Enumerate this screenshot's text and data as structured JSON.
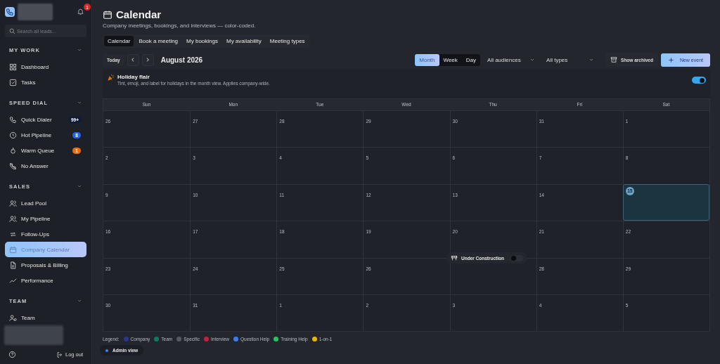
{
  "sidebar": {
    "notifications": "1",
    "search": {
      "placeholder": "Search all leads..."
    },
    "sections": [
      {
        "title": "MY WORK",
        "expanded": true,
        "items": [
          {
            "label": "Dashboard",
            "selected": false
          },
          {
            "label": "Tasks",
            "selected": false
          }
        ]
      },
      {
        "title": "SPEED DIAL",
        "expanded": true,
        "items": [
          {
            "label": "Quick Dialer",
            "selected": false,
            "badge": "99+",
            "color": "#0f1a3a"
          },
          {
            "label": "Hot Pipeline",
            "selected": false,
            "badge": "8",
            "color": "#2563eb"
          },
          {
            "label": "Warm Queue",
            "selected": false,
            "badge": "1",
            "color": "#ea6c0c"
          },
          {
            "label": "No Answer",
            "selected": false
          }
        ]
      },
      {
        "title": "SALES",
        "expanded": true,
        "items": [
          {
            "label": "Lead Pool",
            "selected": false
          },
          {
            "label": "My Pipeline",
            "selected": false
          },
          {
            "label": "Follow-Ups",
            "selected": false
          },
          {
            "label": "Company Calendar",
            "selected": true
          },
          {
            "label": "Proposals & Billing",
            "selected": false
          },
          {
            "label": "Performance",
            "selected": false
          }
        ]
      },
      {
        "title": "TEAM",
        "expanded": true,
        "items": [
          {
            "label": "Team",
            "selected": false
          }
        ]
      }
    ],
    "logout": "Log out"
  },
  "header": {
    "title": "Calendar",
    "subtitle": "Company meetings, bookings, and interviews — color-coded."
  },
  "tabs": [
    {
      "label": "Calendar",
      "selected": true
    },
    {
      "label": "Book a meeting",
      "selected": false
    },
    {
      "label": "My bookings",
      "selected": false
    },
    {
      "label": "My availability",
      "selected": false
    },
    {
      "label": "Meeting types",
      "selected": false
    }
  ],
  "toolbar": {
    "today": "Today",
    "month_label": "August 2026",
    "views": [
      {
        "label": "Month",
        "selected": true
      },
      {
        "label": "Week",
        "selected": false
      },
      {
        "label": "Day",
        "selected": false
      }
    ],
    "audience": "All audiences",
    "types": "All types",
    "show_archived": "Show archived",
    "new_event": "New event"
  },
  "holiday": {
    "title": "Holiday flair",
    "description": "Tint, emoji, and label for holidays in the month view. Applies company-wide.",
    "on": true
  },
  "weekdays": [
    "Sun",
    "Mon",
    "Tue",
    "Wed",
    "Thu",
    "Fri",
    "Sat"
  ],
  "weeks": [
    [
      {
        "date": "26",
        "today": false
      },
      {
        "date": "27",
        "today": false
      },
      {
        "date": "28",
        "today": false
      },
      {
        "date": "29",
        "today": false
      },
      {
        "date": "30",
        "today": false
      },
      {
        "date": "31",
        "today": false
      },
      {
        "date": "1",
        "today": false
      }
    ],
    [
      {
        "date": "2",
        "today": false
      },
      {
        "date": "3",
        "today": false
      },
      {
        "date": "4",
        "today": false
      },
      {
        "date": "5",
        "today": false
      },
      {
        "date": "6",
        "today": false
      },
      {
        "date": "7",
        "today": false
      },
      {
        "date": "8",
        "today": false
      }
    ],
    [
      {
        "date": "9",
        "today": false
      },
      {
        "date": "10",
        "today": false
      },
      {
        "date": "11",
        "today": false
      },
      {
        "date": "12",
        "today": false
      },
      {
        "date": "13",
        "today": false
      },
      {
        "date": "14",
        "today": false
      },
      {
        "date": "15",
        "today": true
      }
    ],
    [
      {
        "date": "16",
        "today": false
      },
      {
        "date": "17",
        "today": false
      },
      {
        "date": "18",
        "today": false
      },
      {
        "date": "19",
        "today": false
      },
      {
        "date": "20",
        "today": false
      },
      {
        "date": "21",
        "today": false
      },
      {
        "date": "22",
        "today": false
      }
    ],
    [
      {
        "date": "23",
        "today": false
      },
      {
        "date": "24",
        "today": false
      },
      {
        "date": "25",
        "today": false
      },
      {
        "date": "26",
        "today": false
      },
      {
        "today": false
      },
      {
        "date": "28",
        "today": false
      },
      {
        "date": "29",
        "today": false
      }
    ],
    [
      {
        "date": "30",
        "today": false
      },
      {
        "date": "31",
        "today": false
      },
      {
        "date": "1",
        "today": false
      },
      {
        "date": "2",
        "today": false
      },
      {
        "date": "3",
        "today": false
      },
      {
        "date": "4",
        "today": false
      },
      {
        "date": "5",
        "today": false
      }
    ]
  ],
  "construction": {
    "label": "Under Construction",
    "on": false
  },
  "legend": {
    "label": "Legend:",
    "items": [
      {
        "label": "Company",
        "color": "#27388a"
      },
      {
        "label": "Team",
        "color": "#0f7a5e"
      },
      {
        "label": "Specific",
        "color": "#555a62"
      },
      {
        "label": "Interview",
        "color": "#c0223f"
      },
      {
        "label": "Question Help",
        "color": "#3b7ef0"
      },
      {
        "label": "Training Help",
        "color": "#22c55e"
      },
      {
        "label": "1-on-1",
        "color": "#eab308"
      }
    ]
  },
  "admin": "Admin view"
}
